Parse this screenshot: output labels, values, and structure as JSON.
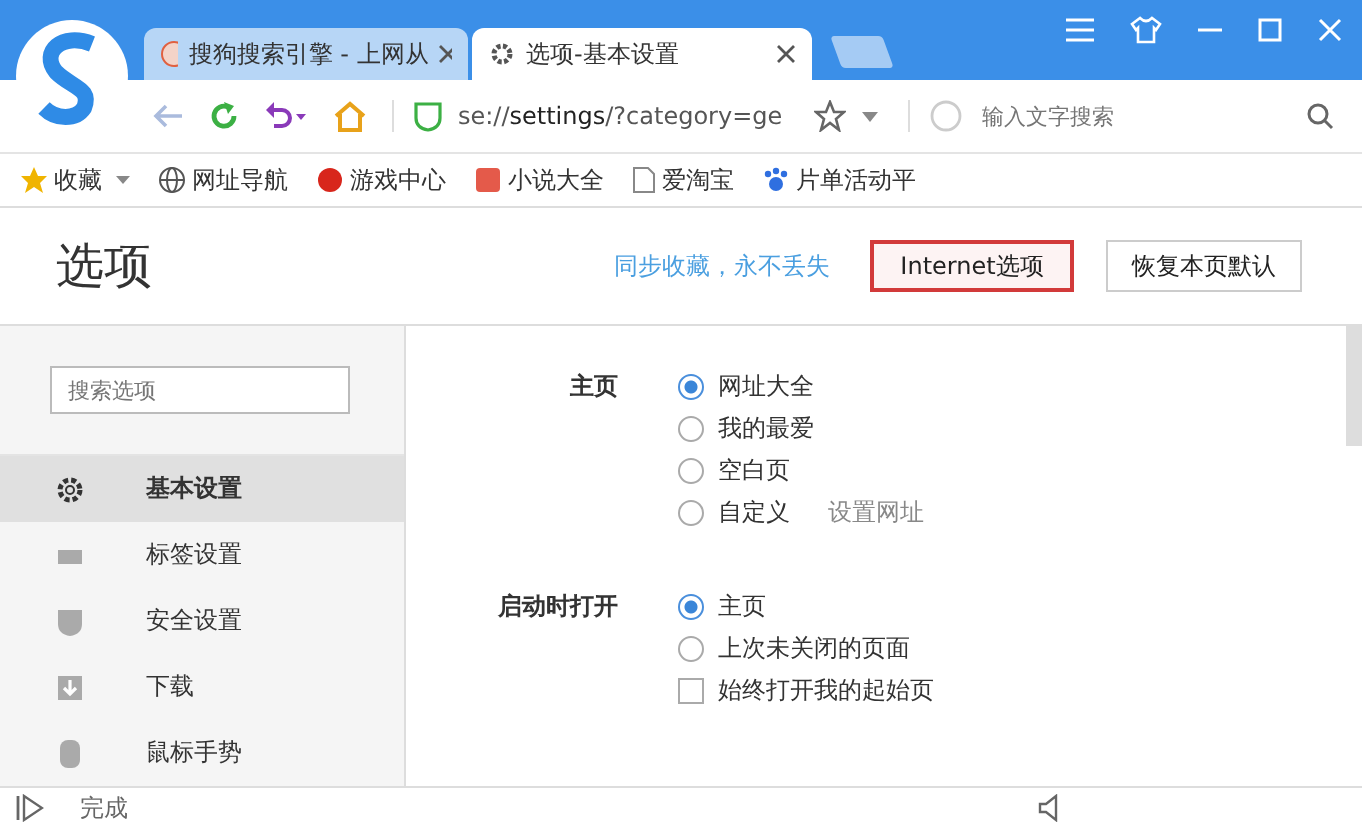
{
  "tabs": [
    {
      "title": "搜狗搜索引擎 - 上网从",
      "selected": false
    },
    {
      "title": "选项-基本设置",
      "selected": true
    }
  ],
  "address": {
    "url_prefix": "se://",
    "url_bold": "settings",
    "url_rest": "/?category=ge"
  },
  "search": {
    "placeholder": "输入文字搜索"
  },
  "bookmarks": [
    {
      "label": "收藏",
      "kind": "star"
    },
    {
      "label": "网址导航",
      "kind": "globe"
    },
    {
      "label": "游戏中心",
      "kind": "game"
    },
    {
      "label": "小说大全",
      "kind": "book"
    },
    {
      "label": "爱淘宝",
      "kind": "page"
    },
    {
      "label": "片单活动平",
      "kind": "paw"
    }
  ],
  "page": {
    "title": "选项",
    "sync_link": "同步收藏，永不丢失",
    "buttons": [
      {
        "label": "Internet选项",
        "highlighted": true
      },
      {
        "label": "恢复本页默认",
        "highlighted": false
      }
    ]
  },
  "sidebar": {
    "search_placeholder": "搜索选项",
    "items": [
      {
        "label": "基本设置",
        "kind": "gear",
        "selected": true
      },
      {
        "label": "标签设置",
        "kind": "tab",
        "selected": false
      },
      {
        "label": "安全设置",
        "kind": "shield",
        "selected": false
      },
      {
        "label": "下载",
        "kind": "download",
        "selected": false
      },
      {
        "label": "鼠标手势",
        "kind": "mouse",
        "selected": false
      }
    ]
  },
  "sections": [
    {
      "label": "主页",
      "options": [
        {
          "kind": "radio",
          "label": "网址大全",
          "selected": true
        },
        {
          "kind": "radio",
          "label": "我的最爱",
          "selected": false
        },
        {
          "kind": "radio",
          "label": "空白页",
          "selected": false
        },
        {
          "kind": "radio",
          "label": "自定义",
          "selected": false,
          "link": "设置网址"
        }
      ]
    },
    {
      "label": "启动时打开",
      "options": [
        {
          "kind": "radio",
          "label": "主页",
          "selected": true
        },
        {
          "kind": "radio",
          "label": "上次未关闭的页面",
          "selected": false
        },
        {
          "kind": "checkbox",
          "label": "始终打开我的起始页",
          "checked": false
        }
      ]
    }
  ],
  "status_bar": {
    "text": "完成"
  }
}
